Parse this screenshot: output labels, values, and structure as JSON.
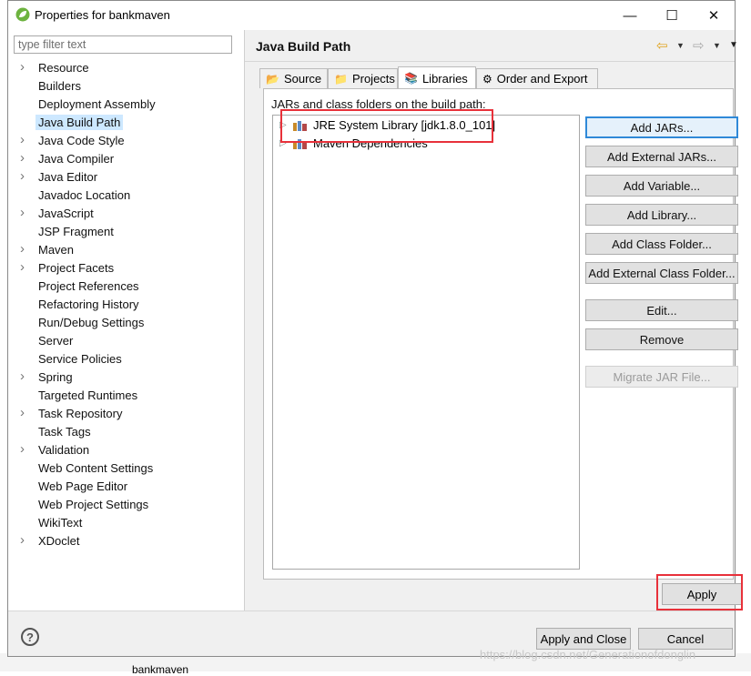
{
  "window": {
    "title": "Properties for bankmaven",
    "controls": {
      "minimize": "—",
      "maximize": "☐",
      "close": "✕"
    }
  },
  "sidebar": {
    "filter_placeholder": "type filter text",
    "items": [
      {
        "label": "Resource",
        "expandable": true
      },
      {
        "label": "Builders",
        "expandable": false
      },
      {
        "label": "Deployment Assembly",
        "expandable": false
      },
      {
        "label": "Java Build Path",
        "expandable": false,
        "selected": true
      },
      {
        "label": "Java Code Style",
        "expandable": true
      },
      {
        "label": "Java Compiler",
        "expandable": true
      },
      {
        "label": "Java Editor",
        "expandable": true
      },
      {
        "label": "Javadoc Location",
        "expandable": false
      },
      {
        "label": "JavaScript",
        "expandable": true
      },
      {
        "label": "JSP Fragment",
        "expandable": false
      },
      {
        "label": "Maven",
        "expandable": true
      },
      {
        "label": "Project Facets",
        "expandable": true
      },
      {
        "label": "Project References",
        "expandable": false
      },
      {
        "label": "Refactoring History",
        "expandable": false
      },
      {
        "label": "Run/Debug Settings",
        "expandable": false
      },
      {
        "label": "Server",
        "expandable": false
      },
      {
        "label": "Service Policies",
        "expandable": false
      },
      {
        "label": "Spring",
        "expandable": true
      },
      {
        "label": "Targeted Runtimes",
        "expandable": false
      },
      {
        "label": "Task Repository",
        "expandable": true
      },
      {
        "label": "Task Tags",
        "expandable": false
      },
      {
        "label": "Validation",
        "expandable": true
      },
      {
        "label": "Web Content Settings",
        "expandable": false
      },
      {
        "label": "Web Page Editor",
        "expandable": false
      },
      {
        "label": "Web Project Settings",
        "expandable": false
      },
      {
        "label": "WikiText",
        "expandable": false
      },
      {
        "label": "XDoclet",
        "expandable": true
      }
    ]
  },
  "page": {
    "title": "Java Build Path",
    "tabs": [
      {
        "label": "Source",
        "icon": "source-folder-icon"
      },
      {
        "label": "Projects",
        "icon": "projects-icon"
      },
      {
        "label": "Libraries",
        "icon": "libraries-icon",
        "active": true
      },
      {
        "label": "Order and Export",
        "icon": "order-export-icon"
      }
    ],
    "list_label": "JARs and class folders on the build path:",
    "libraries": [
      {
        "label": "JRE System Library [jdk1.8.0_101]",
        "icon": "library-icon",
        "highlighted": true
      },
      {
        "label": "Maven Dependencies",
        "icon": "library-icon"
      }
    ],
    "buttons": {
      "add_jars": "Add JARs...",
      "add_external_jars": "Add External JARs...",
      "add_variable": "Add Variable...",
      "add_library": "Add Library...",
      "add_class_folder": "Add Class Folder...",
      "add_external_class_folder": "Add External Class Folder...",
      "edit": "Edit...",
      "remove": "Remove",
      "migrate_jar": "Migrate JAR File..."
    },
    "apply": "Apply"
  },
  "footer": {
    "help": "?",
    "apply_and_close": "Apply and Close",
    "cancel": "Cancel"
  },
  "background": {
    "bottom_text": "bankmaven",
    "watermark": "https://blog.csdn.net/Generationofdonglin"
  },
  "colors": {
    "highlight_border": "#e8313a",
    "selection": "#cde8ff",
    "default_button_border": "#2f89d8"
  }
}
